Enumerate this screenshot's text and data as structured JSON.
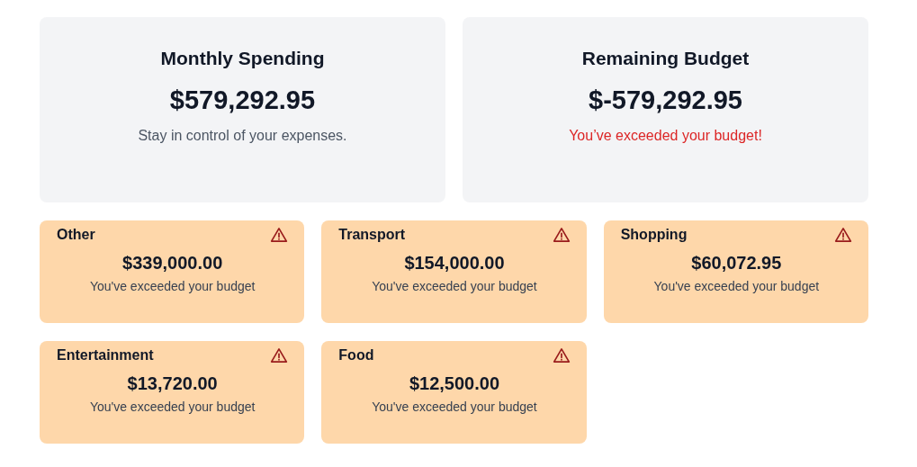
{
  "summary_cards": [
    {
      "title": "Monthly Spending",
      "amount": "$579,292.95",
      "note": "Stay in control of your expenses.",
      "kind": "info"
    },
    {
      "title": "Remaining Budget",
      "amount": "$-579,292.95",
      "note": "You’ve exceeded your budget!",
      "kind": "warning"
    }
  ],
  "categories": [
    {
      "name": "Other",
      "amount": "$339,000.00",
      "message": "You've exceeded your budget",
      "exceeded": true
    },
    {
      "name": "Transport",
      "amount": "$154,000.00",
      "message": "You've exceeded your budget",
      "exceeded": true
    },
    {
      "name": "Shopping",
      "amount": "$60,072.95",
      "message": "You've exceeded your budget",
      "exceeded": true
    },
    {
      "name": "Entertainment",
      "amount": "$13,720.00",
      "message": "You've exceeded your budget",
      "exceeded": true
    },
    {
      "name": "Food",
      "amount": "$12,500.00",
      "message": "You've exceeded your budget",
      "exceeded": true
    }
  ]
}
